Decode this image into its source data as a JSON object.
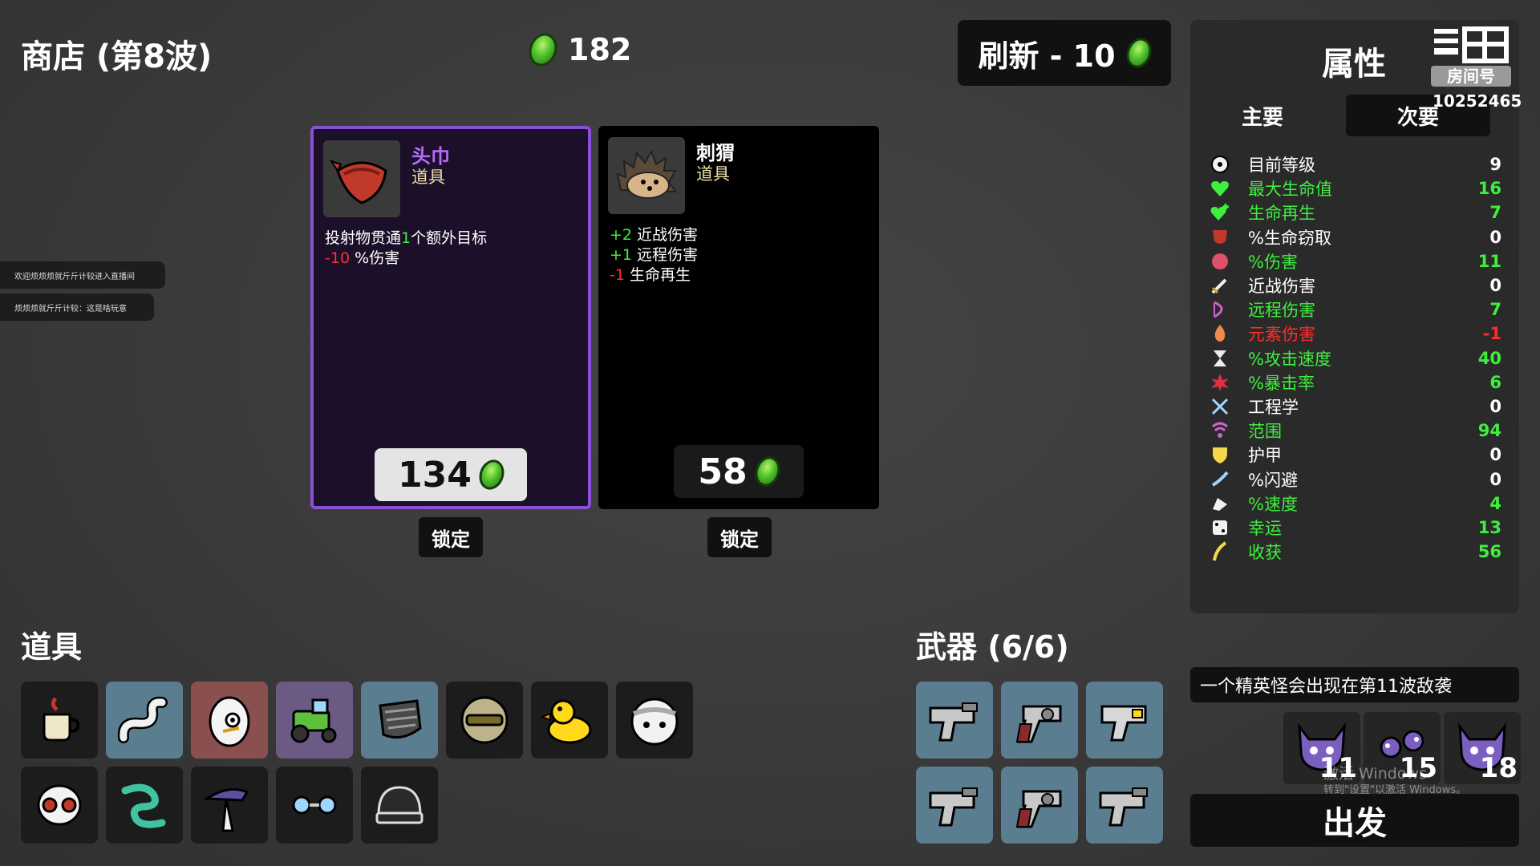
{
  "header": {
    "shop_title": "商店 (第8波)",
    "materials": "182",
    "reroll_label": "刷新 - 10"
  },
  "shop_items": [
    {
      "name": "头巾",
      "type": "道具",
      "rarity_color": "#b86bff",
      "effects": [
        {
          "prefix": "投射物贯通",
          "value": "1",
          "suffix": "个额外目标",
          "value_color": "green"
        },
        {
          "prefix": "",
          "value": "-10",
          "suffix": " %伤害",
          "value_color": "red"
        }
      ],
      "price": "134",
      "lock_label": "锁定"
    },
    {
      "name": "刺猬",
      "type": "道具",
      "rarity_color": "#ffffff",
      "effects": [
        {
          "prefix": "",
          "value": "+2",
          "suffix": " 近战伤害",
          "value_color": "green"
        },
        {
          "prefix": "",
          "value": "+1",
          "suffix": " 远程伤害",
          "value_color": "green"
        },
        {
          "prefix": "",
          "value": "-1",
          "suffix": " 生命再生",
          "value_color": "red"
        }
      ],
      "price": "58",
      "lock_label": "锁定"
    }
  ],
  "chat": [
    "欢迎烦烦烦就斤斤计较进入直播间",
    "烦烦烦就斤斤计较：这是啥玩意"
  ],
  "items_section": {
    "title": "道具",
    "items": [
      "coffee-cup-icon",
      "worm-icon",
      "egg-eye-icon",
      "tractor-icon",
      "cloth-icon",
      "helmet-icon",
      "duck-icon",
      "bandage-head-icon",
      "skull-mask-icon",
      "tentacle-icon",
      "wizard-hat-icon",
      "glasses-icon",
      "beanie-icon"
    ]
  },
  "weapons_section": {
    "title": "武器 (6/6)",
    "weapons": [
      "smg-icon",
      "revolver-icon",
      "laser-gun-icon",
      "smg-icon",
      "revolver-icon",
      "smg-icon"
    ]
  },
  "stats": {
    "title": "属性",
    "tab_primary": "主要",
    "tab_secondary": "次要",
    "room_label": "房间号",
    "room_id": "10252465",
    "rows": [
      {
        "icon": "level-icon",
        "label": "目前等级",
        "value": "9",
        "color": "#ffffff"
      },
      {
        "icon": "heart-icon",
        "label": "最大生命值",
        "value": "16",
        "color": "#3ef03e"
      },
      {
        "icon": "regen-heart-icon",
        "label": "生命再生",
        "value": "7",
        "color": "#3ef03e"
      },
      {
        "icon": "lifesteal-icon",
        "label": "%生命窃取",
        "value": "0",
        "color": "#ffffff"
      },
      {
        "icon": "muscle-icon",
        "label": "%伤害",
        "value": "11",
        "color": "#3ef03e"
      },
      {
        "icon": "sword-icon",
        "label": "近战伤害",
        "value": "0",
        "color": "#ffffff"
      },
      {
        "icon": "bow-icon",
        "label": "远程伤害",
        "value": "7",
        "color": "#3ef03e"
      },
      {
        "icon": "flame-icon",
        "label": "元素伤害",
        "value": "-1",
        "color": "#ff2d2d"
      },
      {
        "icon": "hourglass-icon",
        "label": "%攻击速度",
        "value": "40",
        "color": "#3ef03e"
      },
      {
        "icon": "crit-icon",
        "label": "%暴击率",
        "value": "6",
        "color": "#3ef03e"
      },
      {
        "icon": "wrench-icon",
        "label": "工程学",
        "value": "0",
        "color": "#ffffff"
      },
      {
        "icon": "range-icon",
        "label": "范围",
        "value": "94",
        "color": "#3ef03e"
      },
      {
        "icon": "shield-icon",
        "label": "护甲",
        "value": "0",
        "color": "#ffffff"
      },
      {
        "icon": "dodge-icon",
        "label": "%闪避",
        "value": "0",
        "color": "#ffffff"
      },
      {
        "icon": "speed-icon",
        "label": "%速度",
        "value": "4",
        "color": "#3ef03e"
      },
      {
        "icon": "dice-icon",
        "label": "幸运",
        "value": "13",
        "color": "#3ef03e"
      },
      {
        "icon": "harvest-icon",
        "label": "收获",
        "value": "56",
        "color": "#3ef03e"
      }
    ]
  },
  "elite_notice": "一个精英怪会出现在第11波敌袭",
  "waves": [
    "11",
    "15",
    "18"
  ],
  "go_label": "出发",
  "watermark": {
    "line1": "激活 Windows",
    "line2": "转到\"设置\"以激活 Windows。"
  }
}
